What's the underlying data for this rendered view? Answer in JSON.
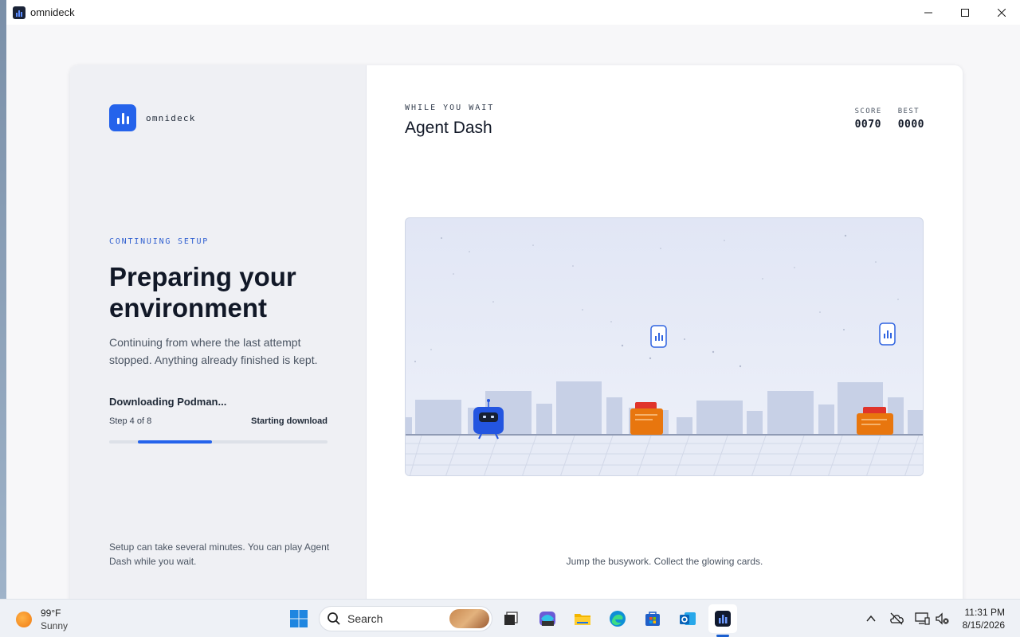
{
  "window": {
    "title": "omnideck"
  },
  "brand": {
    "name": "omnideck"
  },
  "setup": {
    "eyebrow": "CONTINUING SETUP",
    "heading": "Preparing your environment",
    "description": "Continuing from where the last attempt stopped. Anything already finished is kept.",
    "status": "Downloading Podman...",
    "step_label": "Step 4 of 8",
    "phase": "Starting download",
    "progress_start": 0.13,
    "progress_end": 0.47,
    "footnote": "Setup can take several minutes. You can play Agent Dash while you wait.",
    "accent_color": "#2563eb"
  },
  "game": {
    "eyebrow": "WHILE YOU WAIT",
    "title": "Agent Dash",
    "score_label": "SCORE",
    "score": "0070",
    "best_label": "BEST",
    "best": "0000",
    "hint": "Jump the busywork. Collect the glowing cards.",
    "player_color": "#2355e0",
    "obstacle_color": "#e8760e"
  },
  "taskbar": {
    "weather_temp": "99°F",
    "weather_condition": "Sunny",
    "search_placeholder": "Search",
    "time": "11:31 PM",
    "date": "8/15/2026",
    "pinned": [
      "start-icon",
      "search-icon",
      "task-view-icon",
      "copilot-icon",
      "file-explorer-icon",
      "edge-icon",
      "store-icon",
      "outlook-icon",
      "omnideck-icon"
    ],
    "tray": [
      "chevron-up-icon",
      "cloud-offline-icon",
      "display-icon",
      "volume-muted-icon"
    ]
  }
}
